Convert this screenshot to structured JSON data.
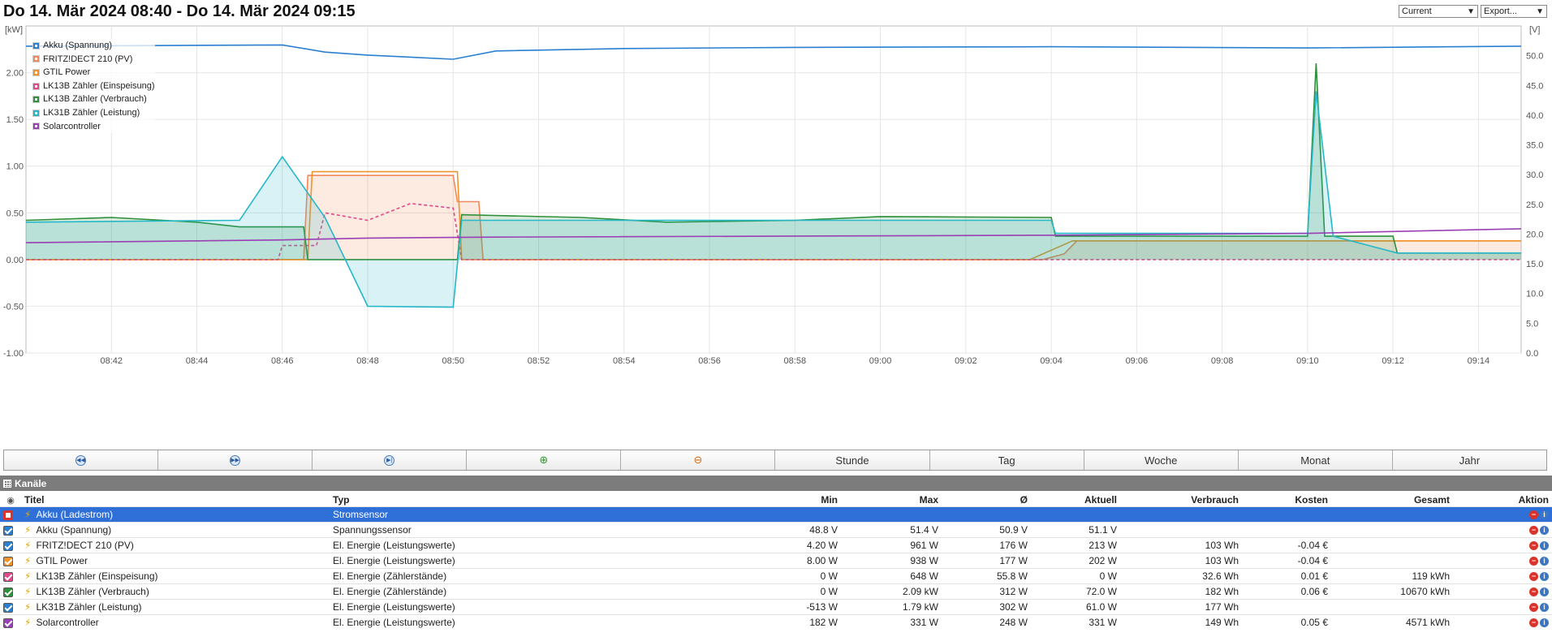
{
  "page": {
    "title": "Do 14. Mär 2024 08:40 - Do 14. Mär 2024 09:15"
  },
  "controls": {
    "current_select": "Current",
    "export_select": "Export..."
  },
  "chart_data": {
    "type": "line",
    "left_axis": {
      "unit": "[kW]",
      "min": -1.0,
      "max": 2.5,
      "ticks": [
        "-1.00",
        "-0.50",
        "0.00",
        "0.50",
        "1.00",
        "1.50",
        "2.00"
      ]
    },
    "right_axis": {
      "unit": "[V]",
      "min": 0,
      "max": 55,
      "ticks": [
        "0.0",
        "5.0",
        "10.0",
        "15.0",
        "20.0",
        "25.0",
        "30.0",
        "35.0",
        "40.0",
        "45.0",
        "50.0"
      ]
    },
    "x_range": [
      "08:40",
      "09:15"
    ],
    "x_ticks": [
      "08:42",
      "08:44",
      "08:46",
      "08:48",
      "08:50",
      "08:52",
      "08:54",
      "08:56",
      "08:58",
      "09:00",
      "09:02",
      "09:04",
      "09:06",
      "09:08",
      "09:10",
      "09:12",
      "09:14"
    ],
    "grid": true,
    "legend_position": "top-left",
    "series": [
      {
        "name": "Akku (Spannung)",
        "color": "#2a7fd0",
        "axis": "right",
        "fill": false,
        "points": [
          [
            "08:40",
            51.6
          ],
          [
            "08:46",
            51.8
          ],
          [
            "08:47",
            50.6
          ],
          [
            "08:48",
            50.1
          ],
          [
            "08:50",
            49.4
          ],
          [
            "08:51",
            50.8
          ],
          [
            "08:54",
            51.2
          ],
          [
            "08:58",
            51.4
          ],
          [
            "09:04",
            51.5
          ],
          [
            "09:10",
            51.3
          ],
          [
            "09:15",
            51.6
          ]
        ]
      },
      {
        "name": "FRITZ!DECT 210 (PV)",
        "color": "#f4885a",
        "axis": "left",
        "fill": true,
        "points": [
          [
            "08:40",
            0.0
          ],
          [
            "08:46.5",
            0.0
          ],
          [
            "08:46.6",
            0.9
          ],
          [
            "08:50",
            0.9
          ],
          [
            "08:50.1",
            0.62
          ],
          [
            "08:50.6",
            0.62
          ],
          [
            "08:50.7",
            0.0
          ],
          [
            "09:03.8",
            0.0
          ],
          [
            "09:04.3",
            0.06
          ],
          [
            "09:04.6",
            0.2
          ],
          [
            "09:15",
            0.2
          ]
        ]
      },
      {
        "name": "GTIL Power",
        "color": "#f2932a",
        "axis": "left",
        "fill": false,
        "points": [
          [
            "08:40",
            0.0
          ],
          [
            "08:46.6",
            0.0
          ],
          [
            "08:46.7",
            0.94
          ],
          [
            "08:50.1",
            0.94
          ],
          [
            "08:50.2",
            0.0
          ],
          [
            "09:03.5",
            0.0
          ],
          [
            "09:04.5",
            0.2
          ],
          [
            "09:15",
            0.2
          ]
        ]
      },
      {
        "name": "LK13B Zähler (Einspeisung)",
        "color": "#e04a8a",
        "axis": "left",
        "fill": false,
        "dashed": true,
        "points": [
          [
            "08:40",
            0.0
          ],
          [
            "08:45.9",
            0.0
          ],
          [
            "08:46",
            0.15
          ],
          [
            "08:46.8",
            0.15
          ],
          [
            "08:47",
            0.5
          ],
          [
            "08:48",
            0.42
          ],
          [
            "08:49",
            0.6
          ],
          [
            "08:50",
            0.55
          ],
          [
            "08:50.2",
            0.0
          ],
          [
            "09:15",
            0.0
          ]
        ]
      },
      {
        "name": "LK13B Zähler (Verbrauch)",
        "color": "#2f8f3a",
        "axis": "left",
        "fill": true,
        "points": [
          [
            "08:40",
            0.42
          ],
          [
            "08:42",
            0.45
          ],
          [
            "08:44",
            0.4
          ],
          [
            "08:45",
            0.35
          ],
          [
            "08:46.5",
            0.35
          ],
          [
            "08:46.6",
            0.0
          ],
          [
            "08:50.1",
            0.0
          ],
          [
            "08:50.2",
            0.48
          ],
          [
            "08:53",
            0.45
          ],
          [
            "08:55",
            0.4
          ],
          [
            "08:58",
            0.42
          ],
          [
            "09:00",
            0.46
          ],
          [
            "09:04",
            0.45
          ],
          [
            "09:04.1",
            0.25
          ],
          [
            "09:10",
            0.25
          ],
          [
            "09:10.2",
            2.1
          ],
          [
            "09:10.4",
            0.25
          ],
          [
            "09:12",
            0.25
          ],
          [
            "09:12.1",
            0.07
          ],
          [
            "09:15",
            0.07
          ]
        ]
      },
      {
        "name": "LK31B Zähler (Leistung)",
        "color": "#26b8c8",
        "axis": "left",
        "fill": true,
        "points": [
          [
            "08:40",
            0.4
          ],
          [
            "08:45",
            0.42
          ],
          [
            "08:46",
            1.1
          ],
          [
            "08:47",
            0.45
          ],
          [
            "08:48",
            -0.5
          ],
          [
            "08:50",
            -0.51
          ],
          [
            "08:50.2",
            0.42
          ],
          [
            "08:55",
            0.42
          ],
          [
            "09:04",
            0.42
          ],
          [
            "09:04.1",
            0.28
          ],
          [
            "09:10",
            0.28
          ],
          [
            "09:10.2",
            1.8
          ],
          [
            "09:10.6",
            0.25
          ],
          [
            "09:12.1",
            0.07
          ],
          [
            "09:15",
            0.07
          ]
        ]
      },
      {
        "name": "Solarcontroller",
        "color": "#9b3fb5",
        "axis": "left",
        "fill": false,
        "points": [
          [
            "08:40",
            0.18
          ],
          [
            "08:46",
            0.21
          ],
          [
            "08:48",
            0.23
          ],
          [
            "08:51",
            0.24
          ],
          [
            "09:04",
            0.26
          ],
          [
            "09:10",
            0.28
          ],
          [
            "09:15",
            0.33
          ]
        ]
      }
    ]
  },
  "nav": {
    "stunde": "Stunde",
    "tag": "Tag",
    "woche": "Woche",
    "monat": "Monat",
    "jahr": "Jahr"
  },
  "channels": {
    "header": "Kanäle",
    "columns": {
      "titel": "Titel",
      "typ": "Typ",
      "min": "Min",
      "max": "Max",
      "avg": "Ø",
      "aktuell": "Aktuell",
      "verbrauch": "Verbrauch",
      "kosten": "Kosten",
      "gesamt": "Gesamt",
      "aktion": "Aktion"
    },
    "rows": [
      {
        "checked": false,
        "color": "#d9342b",
        "title": "Akku (Ladestrom)",
        "type": "Stromsensor",
        "min": "",
        "max": "",
        "avg": "",
        "current": "",
        "consumption": "",
        "cost": "",
        "total": ""
      },
      {
        "checked": true,
        "color": "#2a7fd0",
        "title": "Akku (Spannung)",
        "type": "Spannungssensor",
        "min": "48.8 V",
        "max": "51.4 V",
        "avg": "50.9 V",
        "current": "51.1 V",
        "consumption": "",
        "cost": "",
        "total": ""
      },
      {
        "checked": true,
        "color": "#2a7fd0",
        "title": "FRITZ!DECT 210 (PV)",
        "type": "El. Energie (Leistungswerte)",
        "min": "4.20 W",
        "max": "961 W",
        "avg": "176 W",
        "current": "213 W",
        "consumption": "103 Wh",
        "cost": "-0.04 €",
        "total": ""
      },
      {
        "checked": true,
        "color": "#f2932a",
        "title": "GTIL Power",
        "type": "El. Energie (Leistungswerte)",
        "min": "8.00 W",
        "max": "938 W",
        "avg": "177 W",
        "current": "202 W",
        "consumption": "103 Wh",
        "cost": "-0.04 €",
        "total": ""
      },
      {
        "checked": true,
        "color": "#e04a8a",
        "title": "LK13B Zähler (Einspeisung)",
        "type": "El. Energie (Zählerstände)",
        "min": "0 W",
        "max": "648 W",
        "avg": "55.8 W",
        "current": "0 W",
        "consumption": "32.6 Wh",
        "cost": "0.01 €",
        "total": "119 kWh"
      },
      {
        "checked": true,
        "color": "#2f8f3a",
        "title": "LK13B Zähler (Verbrauch)",
        "type": "El. Energie (Zählerstände)",
        "min": "0 W",
        "max": "2.09 kW",
        "avg": "312 W",
        "current": "72.0 W",
        "consumption": "182 Wh",
        "cost": "0.06 €",
        "total": "10670 kWh"
      },
      {
        "checked": true,
        "color": "#2a7fd0",
        "title": "LK31B Zähler (Leistung)",
        "type": "El. Energie (Leistungswerte)",
        "min": "-513 W",
        "max": "1.79 kW",
        "avg": "302 W",
        "current": "61.0 W",
        "consumption": "177 Wh",
        "cost": "",
        "total": ""
      },
      {
        "checked": true,
        "color": "#9b3fb5",
        "title": "Solarcontroller",
        "type": "El. Energie (Leistungswerte)",
        "min": "182 W",
        "max": "331 W",
        "avg": "248 W",
        "current": "331 W",
        "consumption": "149 Wh",
        "cost": "0.05 €",
        "total": "4571 kWh"
      }
    ]
  }
}
